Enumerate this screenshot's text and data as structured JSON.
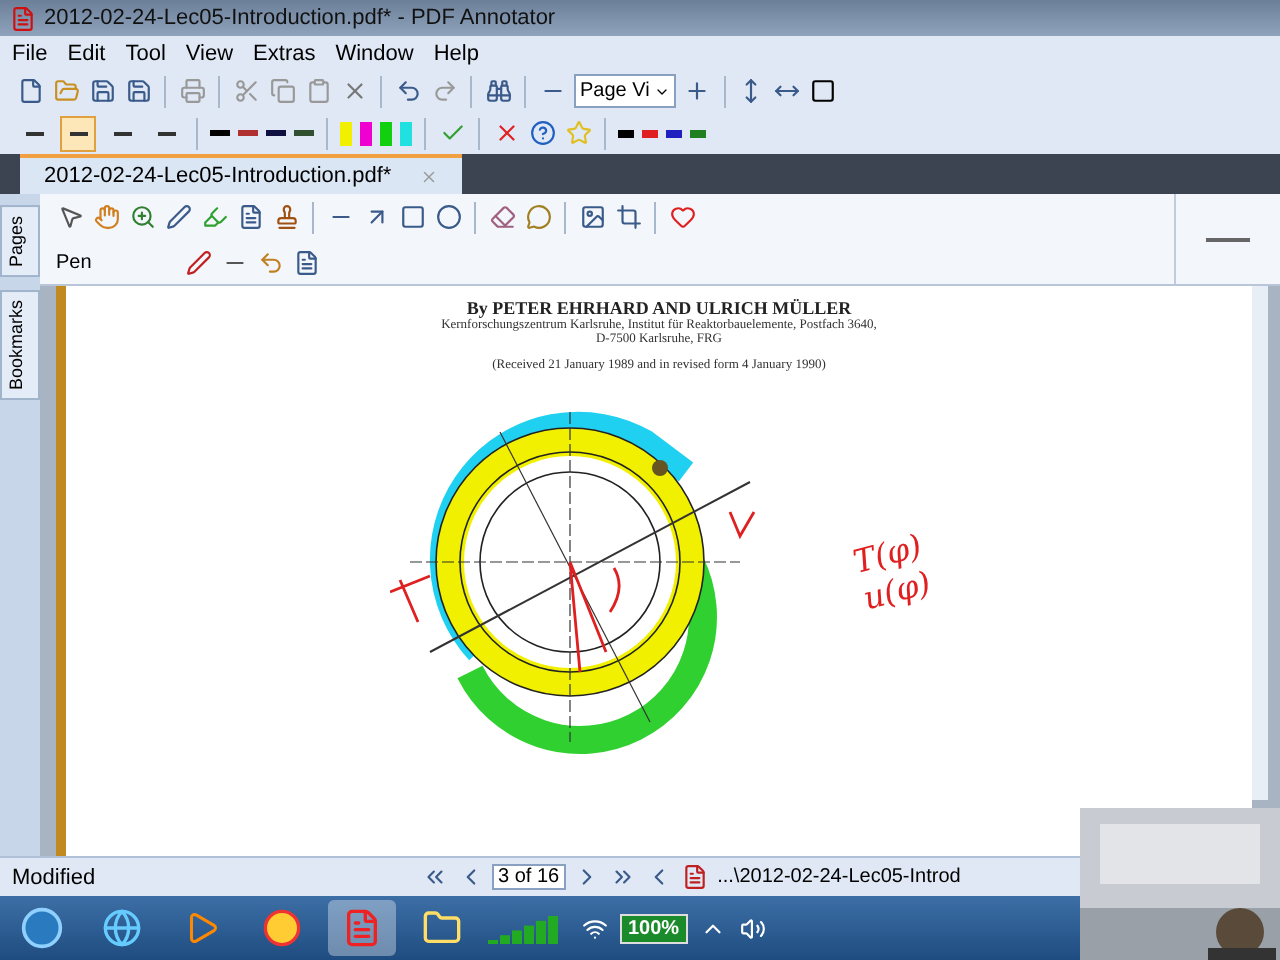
{
  "window": {
    "title": "2012-02-24-Lec05-Introduction.pdf* - PDF Annotator"
  },
  "menu": [
    {
      "label": "File"
    },
    {
      "label": "Edit"
    },
    {
      "label": "Tool"
    },
    {
      "label": "View"
    },
    {
      "label": "Extras"
    },
    {
      "label": "Window"
    },
    {
      "label": "Help"
    }
  ],
  "view_select": {
    "value": "Page Vi"
  },
  "line_widths": [
    {
      "selected": false
    },
    {
      "selected": true
    },
    {
      "selected": false
    },
    {
      "selected": false
    }
  ],
  "pen_colors": [
    {
      "color": "#000000"
    },
    {
      "color": "#b03030"
    },
    {
      "color": "#101040"
    },
    {
      "color": "#305030"
    }
  ],
  "highlighter_colors": [
    {
      "color": "#f0f000"
    },
    {
      "color": "#f000d0"
    },
    {
      "color": "#10d010"
    },
    {
      "color": "#20e0e0"
    }
  ],
  "arrow_colors": [
    {
      "color": "#000000"
    },
    {
      "color": "#e02020"
    },
    {
      "color": "#2020c0"
    },
    {
      "color": "#208020"
    }
  ],
  "document_tab": {
    "label": "2012-02-24-Lec05-Introduction.pdf*",
    "selected": true
  },
  "side_tabs": [
    {
      "label": "Pages"
    },
    {
      "label": "Bookmarks"
    }
  ],
  "tool_label": "Pen",
  "page": {
    "authors": "By PETER EHRHARD AND ULRICH MÜLLER",
    "affiliation": "Kernforschungszentrum Karlsruhe, Institut für Reaktorbauelemente, Postfach 3640,",
    "address": "D-7500 Karlsruhe, FRG",
    "received": "(Received 21 January 1989 and in revised form 4 January 1990)",
    "ink_notes": [
      "T(φ)",
      "u(φ)"
    ]
  },
  "status_bar": {
    "state": "Modified",
    "page_field": "3 of 16",
    "path": "...\\2012-02-24-Lec05-Introd"
  },
  "taskbar": {
    "battery": "100%"
  }
}
